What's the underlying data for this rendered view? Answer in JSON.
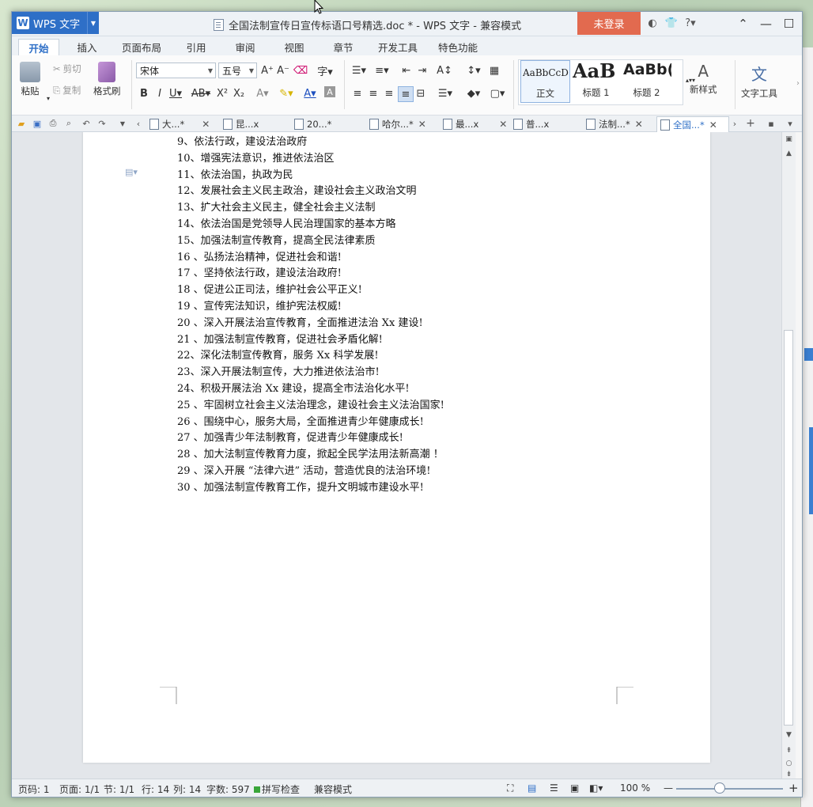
{
  "app": {
    "menu_label": "WPS 文字",
    "window_title": "全国法制宣传日宣传标语口号精选.doc * - WPS 文字 - 兼容模式",
    "login_label": "未登录"
  },
  "ribbon_tabs": [
    "开始",
    "插入",
    "页面布局",
    "引用",
    "审阅",
    "视图",
    "章节",
    "开发工具",
    "特色功能"
  ],
  "clipboard": {
    "paste": "粘贴",
    "cut": "剪切",
    "copy": "复制",
    "format_painter": "格式刷"
  },
  "font": {
    "name": "宋体",
    "size": "五号"
  },
  "styles": [
    {
      "preview": "AaBbCcD",
      "name": "正文"
    },
    {
      "preview": "AaB",
      "name": "标题 1"
    },
    {
      "preview": "AaBb(",
      "name": "标题 2"
    }
  ],
  "new_style": "新样式",
  "text_tools": "文字工具",
  "doc_tabs": [
    "大...*",
    "昆...x",
    "20...*",
    "哈尔...*",
    "最...x",
    "普...x",
    "法制...*",
    "全国...*"
  ],
  "document_lines": [
    "9、依法行政，建设法治政府",
    "10、增强宪法意识，推进依法治区",
    "11、依法治国，执政为民",
    "12、发展社会主义民主政治，建设社会主义政治文明",
    "13、扩大社会主义民主，健全社会主义法制",
    "14、依法治国是党领导人民治理国家的基本方略",
    "15、加强法制宣传教育，提高全民法律素质",
    "16 、弘扬法治精神，促进社会和谐!",
    "17 、坚持依法行政，建设法治政府!",
    "18 、促进公正司法，维护社会公平正义!",
    "19 、宣传宪法知识，维护宪法权威!",
    "20 、深入开展法治宣传教育，全面推进法治 Xx 建设!",
    "21 、加强法制宣传教育，促进社会矛盾化解!",
    "22、深化法制宣传教育，服务 Xx 科学发展!",
    "23、深入开展法制宣传，大力推进依法治市!",
    "24、积极开展法治 Xx 建设，提高全市法治化水平!",
    "25 、牢固树立社会主义法治理念，建设社会主义法治国家!",
    "26 、围绕中心，服务大局，全面推进青少年健康成长!",
    "27 、加强青少年法制教育，促进青少年健康成长!",
    "28 、加大法制宣传教育力度，掀起全民学法用法新高潮 ！",
    "29 、深入开展 “法律六进” 活动，营造优良的法治环境!",
    "30 、加强法制宣传教育工作，提升文明城市建设水平!"
  ],
  "status": {
    "page_num": "页码: 1",
    "pages": "页面: 1/1",
    "section": "节: 1/1",
    "row": "行: 14",
    "col": "列: 14",
    "word_count": "字数: 597",
    "spell_check": "拼写检查",
    "compat_mode": "兼容模式",
    "zoom": "100 %"
  },
  "colors": {
    "accent": "#2e6fc7",
    "login_bg": "#e26a4f"
  }
}
